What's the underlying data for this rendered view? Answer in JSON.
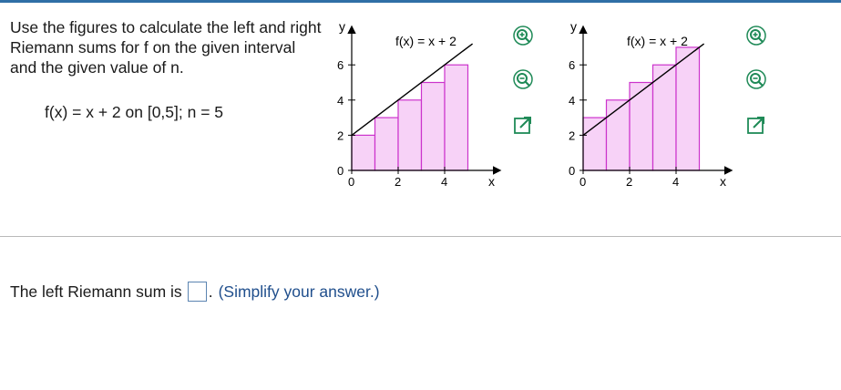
{
  "question": {
    "instruction": "Use the figures to calculate the left and right Riemann sums for f on the given interval and the given value of n.",
    "function_text": "f(x) = x + 2 on [0,5]; n = 5"
  },
  "graphs": [
    {
      "type": "left",
      "function_label": "f(x) = x + 2",
      "x_axis_label": "x",
      "y_axis_label": "y",
      "x_ticks": [
        "0",
        "2",
        "4"
      ],
      "y_ticks": [
        "0",
        "2",
        "4",
        "6"
      ],
      "rect_heights": [
        2,
        3,
        4,
        5,
        6
      ]
    },
    {
      "type": "right",
      "function_label": "f(x) = x + 2",
      "x_axis_label": "x",
      "y_axis_label": "y",
      "x_ticks": [
        "0",
        "2",
        "4"
      ],
      "y_ticks": [
        "0",
        "2",
        "4",
        "6"
      ],
      "rect_heights": [
        3,
        4,
        5,
        6,
        7
      ]
    }
  ],
  "colors": {
    "rect_fill": "#f7d2f7",
    "rect_stroke": "#cc33cc",
    "line": "#000000",
    "top_bar": "#2f6fa6",
    "tool_icon": "#1f8a57",
    "hint": "#1f4e8c"
  },
  "tools": [
    "zoom-in-icon",
    "zoom-out-icon",
    "expand-icon"
  ],
  "answer": {
    "prefix": "The left Riemann sum is",
    "value": "",
    "suffix": ".",
    "hint": "(Simplify your answer.)"
  }
}
